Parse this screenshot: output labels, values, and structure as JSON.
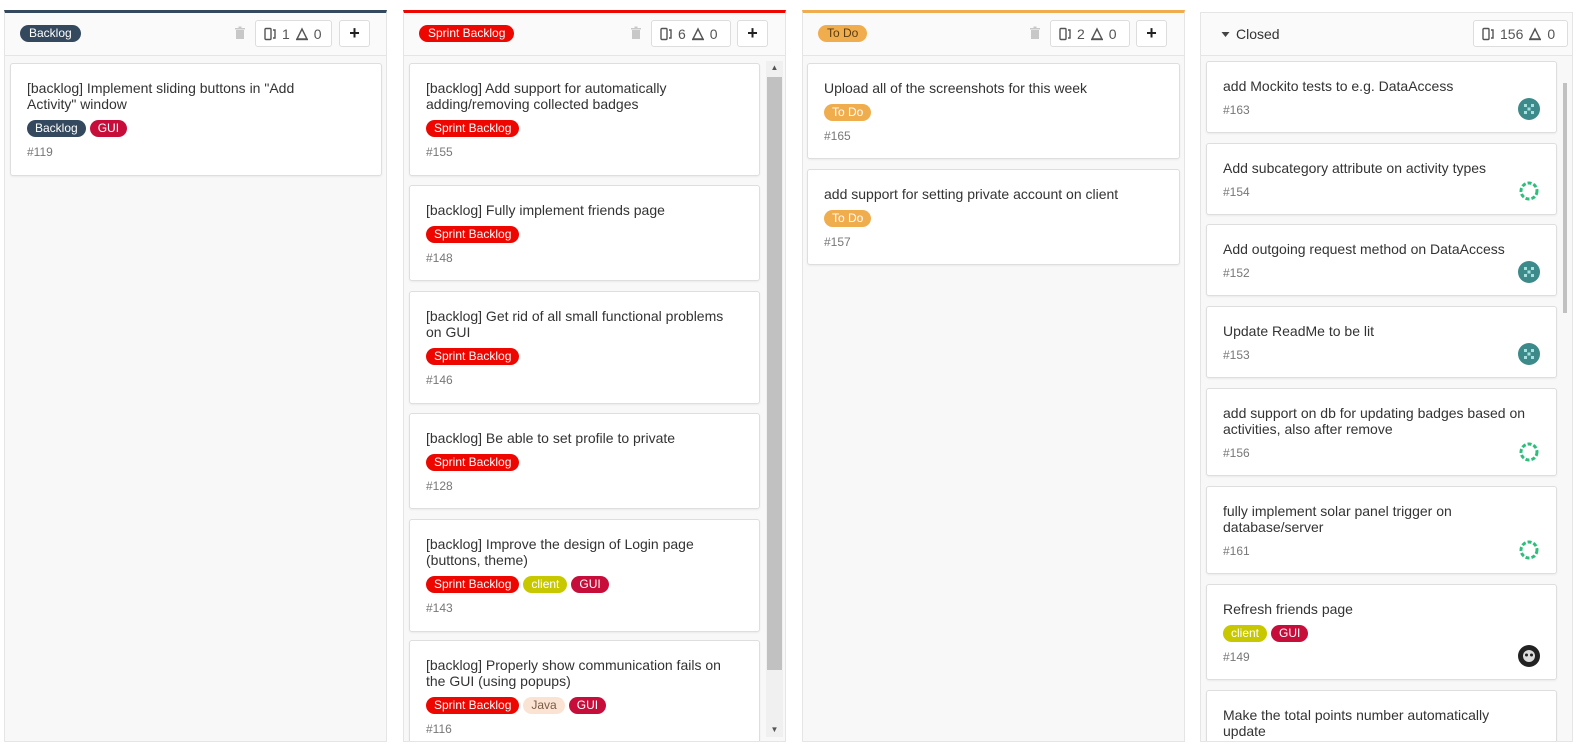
{
  "colors": {
    "backlog": "#34495e",
    "sprint_backlog": "#ee0701",
    "todo": "#f0ad4e",
    "gui": "#c70e3a",
    "client": "#c8c800",
    "java": "#fbe3d4",
    "closed_top": "#e5e5e5"
  },
  "columns": {
    "backlog": {
      "label": "Backlog",
      "issue_count": "1",
      "milestone_count": "0",
      "cards": [
        {
          "title_l1": "[backlog] Implement sliding buttons in \"Add",
          "title_l2": "Activity\" window",
          "labels": [
            "Backlog",
            "GUI"
          ],
          "number": "#119"
        }
      ]
    },
    "sprint": {
      "label": "Sprint Backlog",
      "issue_count": "6",
      "milestone_count": "0",
      "cards": [
        {
          "title_l1": "[backlog] Add support for automatically",
          "title_l2": "adding/removing collected badges",
          "labels": [
            "Sprint Backlog"
          ],
          "number": "#155"
        },
        {
          "title_l1": "[backlog] Fully implement friends page",
          "title_l2": "",
          "labels": [
            "Sprint Backlog"
          ],
          "number": "#148"
        },
        {
          "title_l1": "[backlog] Get rid of all small functional problems",
          "title_l2": "on GUI",
          "labels": [
            "Sprint Backlog"
          ],
          "number": "#146"
        },
        {
          "title_l1": "[backlog] Be able to set profile to private",
          "title_l2": "",
          "labels": [
            "Sprint Backlog"
          ],
          "number": "#128"
        },
        {
          "title_l1": "[backlog] Improve the design of Login page",
          "title_l2": "(buttons, theme)",
          "labels": [
            "Sprint Backlog",
            "client",
            "GUI"
          ],
          "number": "#143"
        },
        {
          "title_l1": "[backlog] Properly show communication fails on",
          "title_l2": "the GUI (using popups)",
          "labels": [
            "Sprint Backlog",
            "Java",
            "GUI"
          ],
          "number": "#116"
        }
      ]
    },
    "todo": {
      "label": "To Do",
      "issue_count": "2",
      "milestone_count": "0",
      "cards": [
        {
          "title_l1": "Upload all of the screenshots for this week",
          "labels": [
            "To Do"
          ],
          "number": "#165"
        },
        {
          "title_l1": "add support for setting private account on client",
          "labels": [
            "To Do"
          ],
          "number": "#157"
        }
      ]
    },
    "closed": {
      "label": "Closed",
      "issue_count": "156",
      "milestone_count": "0",
      "cards": [
        {
          "title_l1": "add Mockito tests to e.g. DataAccess",
          "title_l2": "",
          "number": "#163",
          "avatar": "teal-pixel"
        },
        {
          "title_l1": "Add subcategory attribute on activity types",
          "title_l2": "",
          "number": "#154",
          "avatar": "green-ring"
        },
        {
          "title_l1": "Add outgoing request method on DataAccess",
          "title_l2": "",
          "number": "#152",
          "avatar": "teal-pixel"
        },
        {
          "title_l1": "Update ReadMe to be lit",
          "title_l2": "",
          "number": "#153",
          "avatar": "teal-pixel"
        },
        {
          "title_l1": "add support on db for updating badges based on",
          "title_l2": "activities, also after remove",
          "number": "#156",
          "avatar": "green-ring"
        },
        {
          "title_l1": "fully implement solar panel trigger on",
          "title_l2": "database/server",
          "number": "#161",
          "avatar": "green-ring"
        },
        {
          "title_l1": "Refresh friends page",
          "title_l2": "",
          "labels": [
            "client",
            "GUI"
          ],
          "number": "#149",
          "avatar": "dark-face"
        },
        {
          "title_l1": "Make the total points number automatically",
          "title_l2": "update",
          "number": ""
        }
      ]
    }
  }
}
